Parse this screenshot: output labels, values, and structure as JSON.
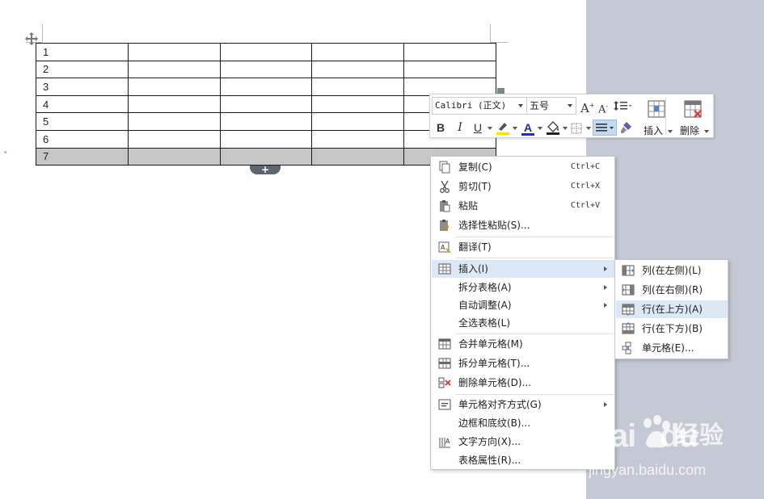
{
  "document": {
    "table": {
      "rows": [
        [
          "1",
          "",
          "",
          "",
          ""
        ],
        [
          "2",
          "",
          "",
          "",
          ""
        ],
        [
          "3",
          "",
          "",
          "",
          ""
        ],
        [
          "4",
          "",
          "",
          "",
          ""
        ],
        [
          "5",
          "",
          "",
          "",
          ""
        ],
        [
          "6",
          "",
          "",
          "",
          ""
        ],
        [
          "7",
          "",
          "",
          "",
          ""
        ]
      ],
      "selected_row": 6,
      "add_row_glyph": "+"
    }
  },
  "mini_toolbar": {
    "font_name": "Calibri (正文)",
    "font_size": "五号",
    "grow_font": "A",
    "shrink_font": "A",
    "bold": "B",
    "italic": "I",
    "underline": "U",
    "font_color": "A",
    "insert_label": "插入",
    "delete_label": "删除",
    "colors": {
      "highlight": "#f5e400",
      "font_color_bar": "#1c2fb5",
      "shading": "#222222"
    }
  },
  "context_menu": {
    "items": [
      {
        "label": "复制(C)",
        "shortcut": "Ctrl+C",
        "icon": "copy-icon"
      },
      {
        "label": "剪切(T)",
        "shortcut": "Ctrl+X",
        "icon": "scissors-icon"
      },
      {
        "label": "粘贴",
        "shortcut": "Ctrl+V",
        "icon": "paste-icon"
      },
      {
        "label": "选择性粘贴(S)...",
        "icon": "paste-special-icon"
      },
      {
        "label": "翻译(T)",
        "icon": "translate-icon"
      },
      {
        "label": "插入(I)",
        "icon": "insert-table-icon",
        "highlighted": true
      },
      {
        "label": "拆分表格(A)"
      },
      {
        "label": "自动调整(A)"
      },
      {
        "label": "全选表格(L)"
      },
      {
        "label": "合并单元格(M)",
        "icon": "merge-cells-icon"
      },
      {
        "label": "拆分单元格(T)...",
        "icon": "split-cells-icon"
      },
      {
        "label": "删除单元格(D)...",
        "icon": "delete-cells-icon"
      },
      {
        "label": "单元格对齐方式(G)",
        "icon": "cell-align-icon"
      },
      {
        "label": "边框和底纹(B)..."
      },
      {
        "label": "文字方向(X)...",
        "icon": "text-direction-icon"
      },
      {
        "label": "表格属性(R)..."
      }
    ]
  },
  "insert_submenu": {
    "items": [
      {
        "label": "列(在左侧)(L)",
        "icon": "insert-col-left-icon"
      },
      {
        "label": "列(在右侧)(R)",
        "icon": "insert-col-right-icon"
      },
      {
        "label": "行(在上方)(A)",
        "icon": "insert-row-above-icon",
        "highlighted": true
      },
      {
        "label": "行(在下方)(B)",
        "icon": "insert-row-below-icon"
      },
      {
        "label": "单元格(E)...",
        "icon": "insert-cell-icon"
      }
    ]
  },
  "watermark": {
    "logo": "Bai",
    "logo_tail": "du",
    "brand": "经验",
    "url": "jingyan.baidu.com"
  }
}
